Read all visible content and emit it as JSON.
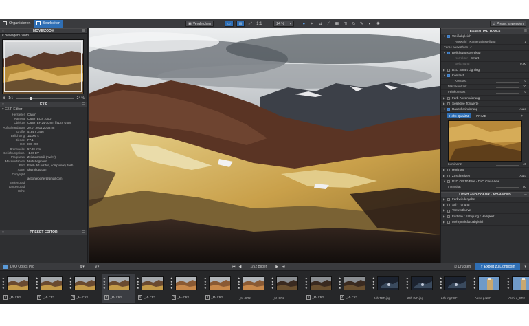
{
  "topbar": {
    "organize": "Organisieren",
    "edit": "Bearbeiten",
    "compare": "Vergleichen",
    "one_to_one": "1:1",
    "zoom": "24 %",
    "preset_apply": "Preset anwenden"
  },
  "left_panel": {
    "move_zoom_title": "MOVE/ZOOM",
    "move_zoom_sub": "Bewegen/Zoom",
    "zoom_ratio": "1:1",
    "zoom_value": "24 %",
    "exif_title": "EXIF",
    "exif_sub": "EXIF Editor",
    "exif_rows": [
      {
        "k": "Hersteller",
        "v": "Canon"
      },
      {
        "k": "Kamera",
        "v": "Canon EOS 100D"
      },
      {
        "k": "Objektiv",
        "v": "Canon EF 24-70mm f/4L IS USM"
      },
      {
        "k": "Aufnahmedatum",
        "v": "20.07.2014 20:08:08"
      },
      {
        "k": "Größe",
        "v": "5184 x 3456"
      },
      {
        "k": "Belichtung",
        "v": "1/1000 s"
      },
      {
        "k": "Blende",
        "v": "F7.1"
      },
      {
        "k": "ISO",
        "v": "ISO 200"
      },
      {
        "k": "Brennweite",
        "v": "57.00 mm"
      },
      {
        "k": "Belichtungskorr.",
        "v": "-1.00 EV"
      },
      {
        "k": "Programm",
        "v": "Zeitautomatik (Av/Av)"
      },
      {
        "k": "Messverfahren",
        "v": "Multi-Segment"
      },
      {
        "k": "Blitz",
        "v": "Flash did not fire, compulsory flash..."
      },
      {
        "k": "Autor",
        "v": "obarphoto.com"
      },
      {
        "k": "Copyright",
        "v": ""
      },
      {
        "k": "",
        "v": "actionreporter@gmail.com"
      },
      {
        "k": "Breitengrad",
        "v": ""
      },
      {
        "k": "Längengrad",
        "v": ""
      },
      {
        "k": "Höhe",
        "v": ""
      }
    ],
    "preset_editor_title": "PRESET EDITOR"
  },
  "right_panel": {
    "title": "ESSENTIAL TOOLS",
    "white_balance": "Weißabgleich",
    "wb_label": "Auswahl",
    "wb_value": "Kameraeinstellung",
    "wb_num": "1",
    "wb_picker": "Farbe auswählen",
    "exposure": "Belichtungskorrektur",
    "exp_label": "Korrektur",
    "exp_value": "Smart",
    "exp_param": "Belichtung",
    "exp_num": "0,00",
    "smart_lighting": "DxO Smart Lighting",
    "contrast": "Kontrast",
    "contrast_label": "Kontrast",
    "contrast_val": "0",
    "micro": "Mikrokontrast",
    "micro_val": "10",
    "fine": "Feinkontrast",
    "fine_val": "0",
    "color_accent": "Farb-Akzentuierung",
    "tone": "Selektive Tonwerte",
    "noise": "Rauschminderung",
    "noise_mode": "Auto",
    "tab_hq": "Hohe Qualität",
    "tab_prime": "PRIME",
    "luminance": "Luminanz",
    "lum_val": "40",
    "horizon": "Horizont",
    "crop": "Zuschneiden",
    "crop_mode": "Auto",
    "clearview": "DxO OP 10 Elite - DxO ClearView",
    "intensity": "Intensität",
    "intensity_val": "50",
    "section2": "LIGHT AND COLOR - ADVANCED",
    "adv": [
      "Farbwiedergabe",
      "Stil - Tonung",
      "Tonwertkurve",
      "Farbton / Sättigung / Helligkeit",
      "Mehrpunktfarbabgleich"
    ]
  },
  "filmstrip_bar": {
    "folder": "DxO Optics Pro",
    "count": "1/52 Bilder",
    "print": "Drucken",
    "export": "Export zu Lightroom"
  },
  "thumbs": [
    {
      "n": "1",
      "name": "_M-.CR2",
      "kind": "land"
    },
    {
      "n": "2",
      "name": "_M-.CR2",
      "kind": "land"
    },
    {
      "n": "3",
      "name": "_M-.CR2",
      "kind": "land"
    },
    {
      "n": "4",
      "name": "_M-.CR2",
      "kind": "land"
    },
    {
      "n": "5",
      "name": "_M-.CR2",
      "kind": "land"
    },
    {
      "n": "1",
      "name": "_M-.CR2",
      "kind": "warm"
    },
    {
      "n": "2",
      "name": "_M-.CR2",
      "kind": "warm"
    },
    {
      "n": "",
      "name": "_M-.CR2",
      "kind": "warm"
    },
    {
      "n": "",
      "name": "_M-.CR2",
      "kind": "dark"
    },
    {
      "n": "5",
      "name": "_M-.CR2",
      "kind": "dark"
    },
    {
      "n": "4",
      "name": "_M-.CR2",
      "kind": "dark"
    },
    {
      "n": "",
      "name": "24h-TER.jpg",
      "kind": "night"
    },
    {
      "n": "",
      "name": "24h-IMR.jpg",
      "kind": "night"
    },
    {
      "n": "",
      "name": "24h-ing.NEF",
      "kind": "night"
    },
    {
      "n": "",
      "name": "Alese-p.NEF",
      "kind": "tower"
    },
    {
      "n": "",
      "name": "Archi-e_CR2",
      "kind": "tower"
    }
  ]
}
